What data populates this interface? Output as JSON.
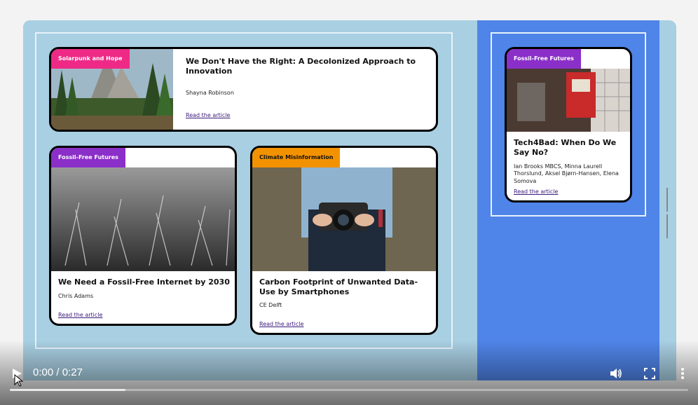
{
  "player": {
    "time_current": "0:00",
    "time_separator": "/",
    "time_total": "0:27",
    "progress_buffered": 0.17
  },
  "colors": {
    "left_bg": "#a8cfe2",
    "right_bg": "#4f84e8",
    "tag_solarpunk": "#ee2a86",
    "tag_fossil": "#8b2fc9",
    "tag_climate": "#f39200"
  },
  "cards": [
    {
      "tag": "Solarpunk and Hope",
      "title": "We Don't Have the Right: A Decolonized Approach to Innovation",
      "author": "Shayna Robinson",
      "link": "Read the article"
    },
    {
      "tag": "Fossil-Free Futures",
      "title": "We Need a Fossil-Free Internet by 2030",
      "author": "Chris Adams",
      "link": "Read the article"
    },
    {
      "tag": "Climate Misinformation",
      "title": "Carbon Footprint of Unwanted Data-Use by Smartphones",
      "author": "CE Delft",
      "link": "Read the article"
    },
    {
      "tag": "Fossil-Free Futures",
      "title": "Tech4Bad: When Do We Say No?",
      "author": "Ian Brooks MBCS, Minna Laurell Thorslund, Aksel Bjørn-Hansen, Elena Somova",
      "link": "Read the article"
    }
  ],
  "icons": {
    "play": "play-icon",
    "volume": "volume-icon",
    "fullscreen": "fullscreen-icon",
    "more": "more-vertical-icon"
  }
}
